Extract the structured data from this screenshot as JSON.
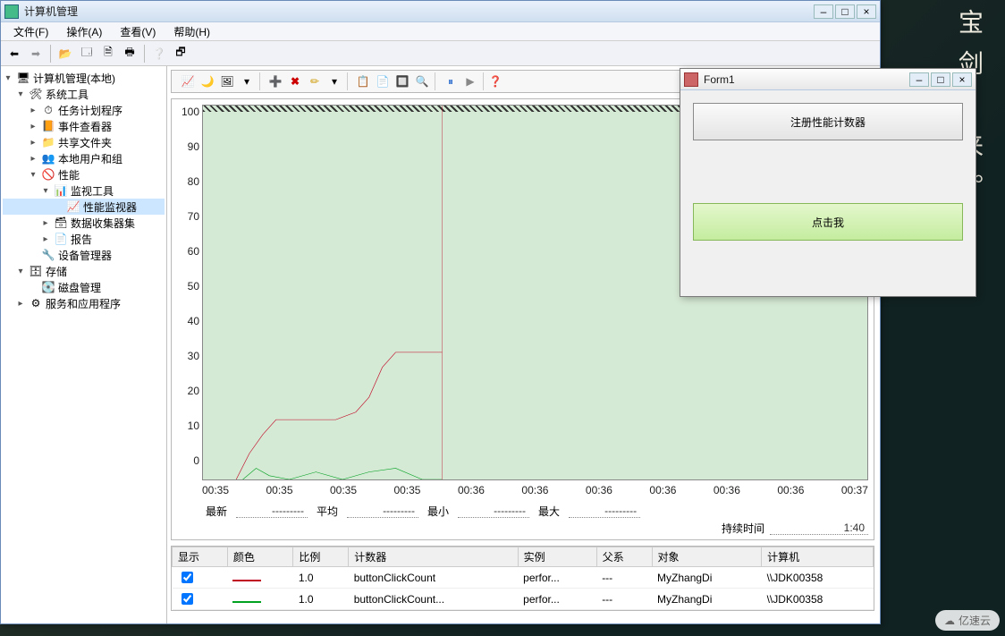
{
  "desktop": {
    "poem": "宝剑…来。"
  },
  "window": {
    "title": "计算机管理",
    "sys_buttons": {
      "min": "–",
      "max": "□",
      "close": "×"
    }
  },
  "menu": {
    "file": "文件(F)",
    "action": "操作(A)",
    "view": "查看(V)",
    "help": "帮助(H)"
  },
  "tree": {
    "root": "计算机管理(本地)",
    "nodes": [
      {
        "l": 1,
        "exp": "▾",
        "icon": "🛠",
        "label": "系统工具"
      },
      {
        "l": 2,
        "exp": "▸",
        "icon": "⏱",
        "label": "任务计划程序"
      },
      {
        "l": 2,
        "exp": "▸",
        "icon": "📙",
        "label": "事件查看器"
      },
      {
        "l": 2,
        "exp": "▸",
        "icon": "📁",
        "label": "共享文件夹"
      },
      {
        "l": 2,
        "exp": "▸",
        "icon": "👥",
        "label": "本地用户和组"
      },
      {
        "l": 2,
        "exp": "▾",
        "icon": "🚫",
        "label": "性能"
      },
      {
        "l": 3,
        "exp": "▾",
        "icon": "📊",
        "label": "监视工具"
      },
      {
        "l": 4,
        "exp": "",
        "icon": "📈",
        "label": "性能监视器",
        "sel": true
      },
      {
        "l": 3,
        "exp": "▸",
        "icon": "🗃",
        "label": "数据收集器集"
      },
      {
        "l": 3,
        "exp": "▸",
        "icon": "📄",
        "label": "报告"
      },
      {
        "l": 2,
        "exp": "",
        "icon": "🔧",
        "label": "设备管理器"
      },
      {
        "l": 1,
        "exp": "▾",
        "icon": "🗄",
        "label": "存储"
      },
      {
        "l": 2,
        "exp": "",
        "icon": "💽",
        "label": "磁盘管理"
      },
      {
        "l": 1,
        "exp": "▸",
        "icon": "⚙",
        "label": "服务和应用程序"
      }
    ]
  },
  "chart_toolbar": {
    "view_group": [
      "📈",
      "🌙",
      "🖼",
      "▾"
    ],
    "edit_group": [
      "➕",
      "✖",
      "✏",
      "▾"
    ],
    "clip_group": [
      "📋",
      "📄",
      "🔲",
      "🔍"
    ],
    "play_group": [
      "⏸",
      "▶"
    ],
    "help": "❓"
  },
  "chart_data": {
    "type": "line",
    "xlabel": "",
    "ylabel": "",
    "ylim": [
      0,
      100
    ],
    "yticks": [
      100,
      90,
      80,
      70,
      60,
      50,
      40,
      30,
      20,
      10,
      0
    ],
    "xticks": [
      "00:35",
      "00:35",
      "00:35",
      "00:35",
      "00:36",
      "00:36",
      "00:36",
      "00:36",
      "00:36",
      "00:36",
      "00:37"
    ],
    "cursor_x_pct": 36,
    "series": [
      {
        "name": "buttonClickCount (red)",
        "color": "#c00020",
        "points": [
          [
            5,
            0
          ],
          [
            7,
            7
          ],
          [
            9,
            12
          ],
          [
            11,
            16
          ],
          [
            15,
            16
          ],
          [
            17,
            16
          ],
          [
            20,
            16
          ],
          [
            23,
            18
          ],
          [
            25,
            22
          ],
          [
            27,
            30
          ],
          [
            29,
            34
          ],
          [
            33,
            34
          ],
          [
            36,
            34
          ]
        ]
      },
      {
        "name": "buttonClickCount (green)",
        "color": "#00a020",
        "points": [
          [
            6,
            0
          ],
          [
            8,
            3
          ],
          [
            10,
            1
          ],
          [
            13,
            0
          ],
          [
            17,
            2
          ],
          [
            21,
            0
          ],
          [
            25,
            2
          ],
          [
            29,
            3
          ],
          [
            33,
            0
          ],
          [
            36,
            0
          ]
        ]
      }
    ]
  },
  "stats": {
    "latest_lbl": "最新",
    "latest": "---------",
    "avg_lbl": "平均",
    "avg": "---------",
    "min_lbl": "最小",
    "min": "---------",
    "max_lbl": "最大",
    "max": "---------",
    "dur_lbl": "持续时间",
    "dur": "1:40"
  },
  "counters": {
    "headers": {
      "show": "显示",
      "color": "颜色",
      "scale": "比例",
      "counter": "计数器",
      "instance": "实例",
      "parent": "父系",
      "object": "对象",
      "computer": "计算机"
    },
    "rows": [
      {
        "show": true,
        "color": "#c00020",
        "scale": "1.0",
        "counter": "buttonClickCount",
        "instance": "perfor...",
        "parent": "---",
        "object": "MyZhangDi",
        "computer": "\\\\JDK00358"
      },
      {
        "show": true,
        "color": "#00a020",
        "scale": "1.0",
        "counter": "buttonClickCount...",
        "instance": "perfor...",
        "parent": "---",
        "object": "MyZhangDi",
        "computer": "\\\\JDK00358"
      }
    ]
  },
  "form1": {
    "title": "Form1",
    "btn_register": "注册性能计数器",
    "btn_click": "点击我"
  },
  "watermark": "亿速云"
}
